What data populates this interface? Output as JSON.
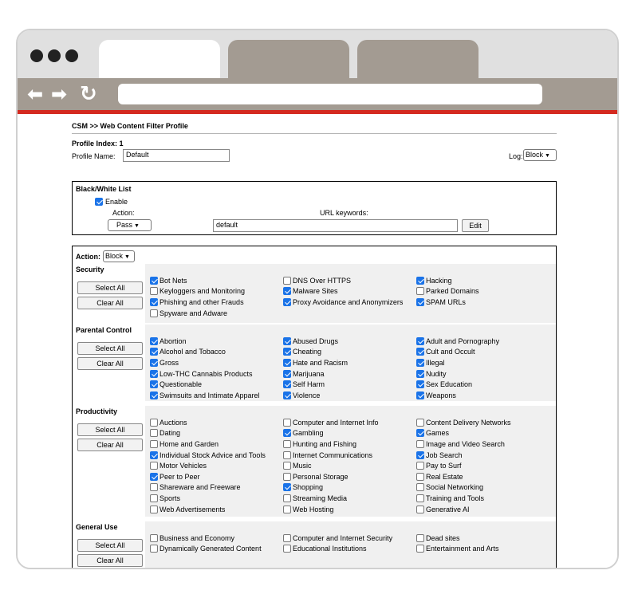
{
  "page": {
    "title": "CSM >> Web Content Filter Profile",
    "profile_index": "Profile Index: 1",
    "profile_name_label": "Profile Name:",
    "profile_name_value": "Default",
    "log_label": "Log:",
    "log_value": "Block"
  },
  "black_white_list": {
    "title": "Black/White List",
    "enable_label": "Enable",
    "enable_checked": true,
    "action_label": "Action:",
    "action_value": "Pass",
    "url_keywords_label": "URL keywords:",
    "url_keywords_value": "default",
    "edit_label": "Edit"
  },
  "filter": {
    "action_label": "Action:",
    "action_value": "Block",
    "select_all_label": "Select All",
    "clear_all_label": "Clear All",
    "categories": [
      {
        "name": "Security",
        "columns": [
          [
            {
              "label": "Bot Nets",
              "checked": true
            },
            {
              "label": "Keyloggers and Monitoring",
              "checked": false
            },
            {
              "label": "Phishing and other Frauds",
              "checked": true
            },
            {
              "label": "Spyware and Adware",
              "checked": false
            }
          ],
          [
            {
              "label": "DNS Over HTTPS",
              "checked": false
            },
            {
              "label": "Malware Sites",
              "checked": true
            },
            {
              "label": "Proxy Avoidance and Anonymizers",
              "checked": true
            }
          ],
          [
            {
              "label": "Hacking",
              "checked": true
            },
            {
              "label": "Parked Domains",
              "checked": false
            },
            {
              "label": "SPAM URLs",
              "checked": true
            }
          ]
        ]
      },
      {
        "name": "Parental Control",
        "columns": [
          [
            {
              "label": "Abortion",
              "checked": true
            },
            {
              "label": "Alcohol and Tobacco",
              "checked": true
            },
            {
              "label": "Gross",
              "checked": true
            },
            {
              "label": "Low-THC Cannabis Products",
              "checked": true
            },
            {
              "label": "Questionable",
              "checked": true
            },
            {
              "label": "Swimsuits and Intimate Apparel",
              "checked": true
            }
          ],
          [
            {
              "label": "Abused Drugs",
              "checked": true
            },
            {
              "label": "Cheating",
              "checked": true
            },
            {
              "label": "Hate and Racism",
              "checked": true
            },
            {
              "label": "Marijuana",
              "checked": true
            },
            {
              "label": "Self Harm",
              "checked": true
            },
            {
              "label": "Violence",
              "checked": true
            }
          ],
          [
            {
              "label": "Adult and Pornography",
              "checked": true
            },
            {
              "label": "Cult and Occult",
              "checked": true
            },
            {
              "label": "Illegal",
              "checked": true
            },
            {
              "label": "Nudity",
              "checked": true
            },
            {
              "label": "Sex Education",
              "checked": true
            },
            {
              "label": "Weapons",
              "checked": true
            }
          ]
        ]
      },
      {
        "name": "Productivity",
        "columns": [
          [
            {
              "label": "Auctions",
              "checked": false
            },
            {
              "label": "Dating",
              "checked": false
            },
            {
              "label": "Home and Garden",
              "checked": false
            },
            {
              "label": "Individual Stock Advice and Tools",
              "checked": true
            },
            {
              "label": "Motor Vehicles",
              "checked": false
            },
            {
              "label": "Peer to Peer",
              "checked": true
            },
            {
              "label": "Shareware and Freeware",
              "checked": false
            },
            {
              "label": "Sports",
              "checked": false
            },
            {
              "label": "Web Advertisements",
              "checked": false
            }
          ],
          [
            {
              "label": "Computer and Internet Info",
              "checked": false
            },
            {
              "label": "Gambling",
              "checked": true
            },
            {
              "label": "Hunting and Fishing",
              "checked": false
            },
            {
              "label": "Internet Communications",
              "checked": false
            },
            {
              "label": "Music",
              "checked": false
            },
            {
              "label": "Personal Storage",
              "checked": false
            },
            {
              "label": "Shopping",
              "checked": true
            },
            {
              "label": "Streaming Media",
              "checked": false
            },
            {
              "label": "Web Hosting",
              "checked": false
            }
          ],
          [
            {
              "label": "Content Delivery Networks",
              "checked": false
            },
            {
              "label": "Games",
              "checked": true
            },
            {
              "label": "Image and Video Search",
              "checked": false
            },
            {
              "label": "Job Search",
              "checked": true
            },
            {
              "label": "Pay to Surf",
              "checked": false
            },
            {
              "label": "Real Estate",
              "checked": false
            },
            {
              "label": "Social Networking",
              "checked": false
            },
            {
              "label": "Training and Tools",
              "checked": false
            },
            {
              "label": "Generative AI",
              "checked": false
            }
          ]
        ]
      },
      {
        "name": "General Use",
        "columns": [
          [
            {
              "label": "Business and Economy",
              "checked": false
            },
            {
              "label": "Dynamically Generated Content",
              "checked": false
            }
          ],
          [
            {
              "label": "Computer and Internet Security",
              "checked": false
            },
            {
              "label": "Educational Institutions",
              "checked": false
            }
          ],
          [
            {
              "label": "Dead sites",
              "checked": false
            },
            {
              "label": "Entertainment and Arts",
              "checked": false
            }
          ]
        ]
      }
    ]
  }
}
